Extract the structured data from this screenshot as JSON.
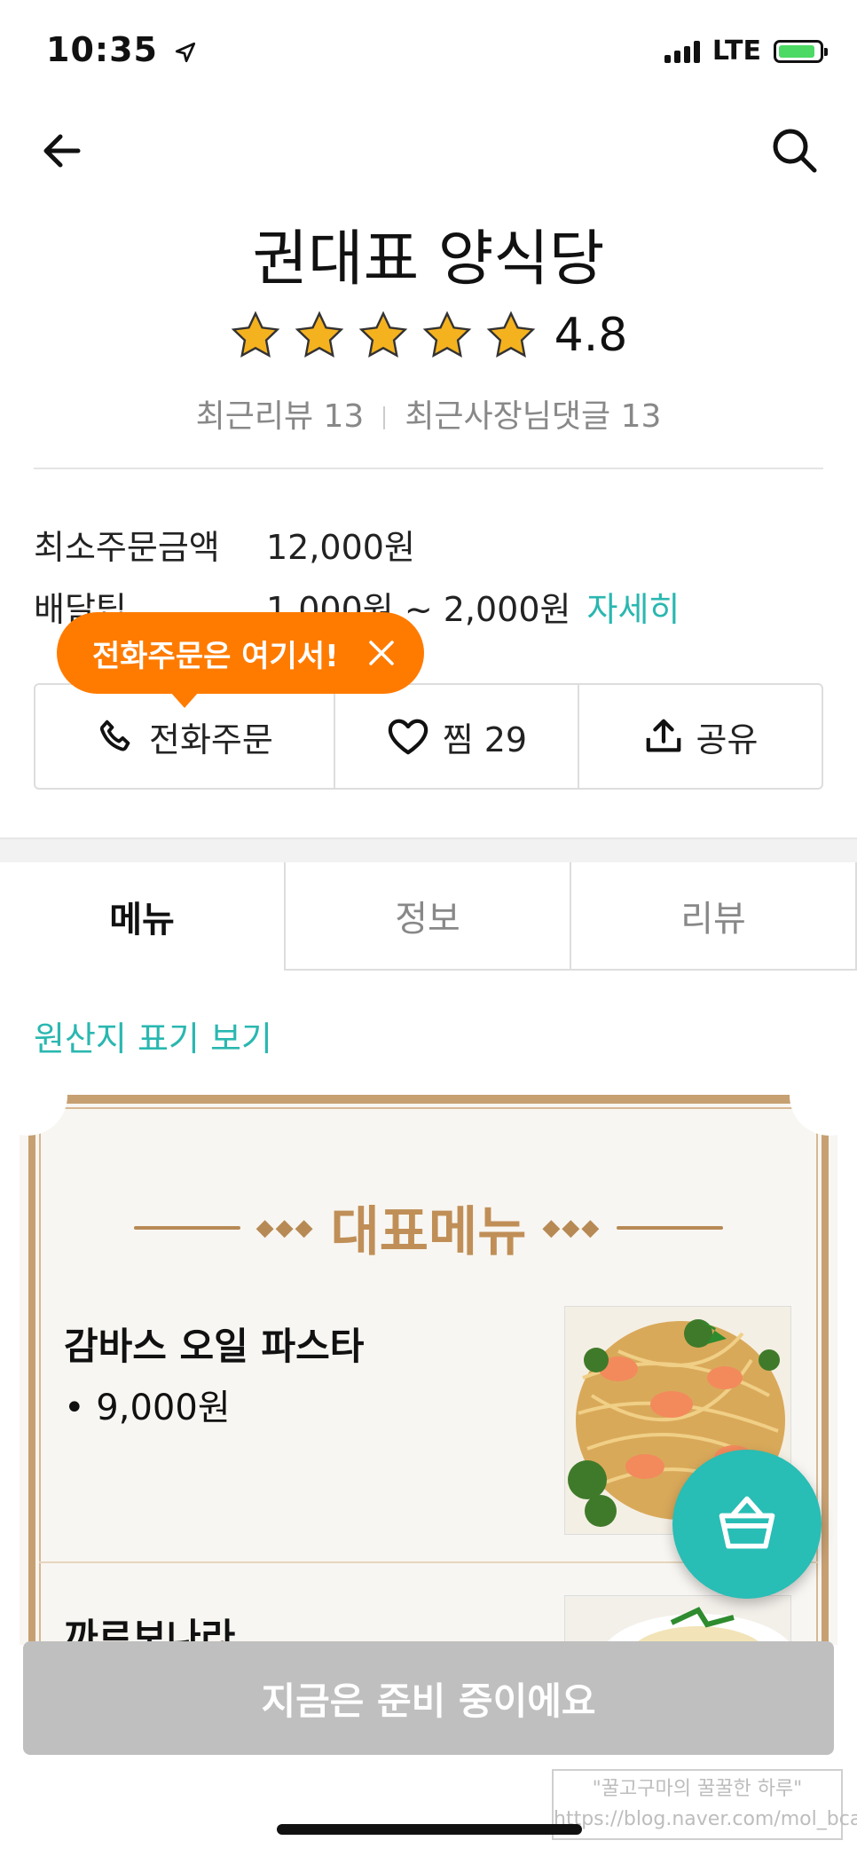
{
  "status_bar": {
    "time": "10:35",
    "network": "LTE"
  },
  "header": {
    "back_icon": "arrow-left-icon",
    "search_icon": "search-icon"
  },
  "store": {
    "name": "권대표 양식당",
    "rating": "4.8",
    "stars": 5,
    "recent_reviews": "최근리뷰 13",
    "owner_comments": "최근사장님댓글 13"
  },
  "info": {
    "min_order_label": "최소주문금액",
    "min_order_value": "12,000원",
    "delivery_tip_label": "배달팁",
    "delivery_tip_value": "1,000원 ~ 2,000원",
    "detail_link": "자세히"
  },
  "tooltip": {
    "text": "전화주문은 여기서!"
  },
  "actions": {
    "call": "전화주문",
    "like": "찜 29",
    "share": "공유"
  },
  "tabs": [
    {
      "label": "메뉴",
      "active": true
    },
    {
      "label": "정보",
      "active": false
    },
    {
      "label": "리뷰",
      "active": false
    }
  ],
  "origin_link": "원산지 표기 보기",
  "menu_board": {
    "heading": "대표메뉴",
    "items": [
      {
        "name": "감바스 오일 파스타",
        "price": "• 9,000원"
      },
      {
        "name": "까르보나라",
        "price": ""
      }
    ]
  },
  "bottom_button": "지금은 준비 중이에요",
  "watermark": {
    "line1": "\"꿀고구마의 꿀꿀한 하루\"",
    "line2": "https://blog.naver.com/mol_bca"
  },
  "colors": {
    "accent": "#2ab7b0",
    "tooltip": "#ff7b00",
    "star": "#f5b21f",
    "board": "#c7a072",
    "fab": "#28bdb5",
    "disabled": "#bfbfbf"
  }
}
